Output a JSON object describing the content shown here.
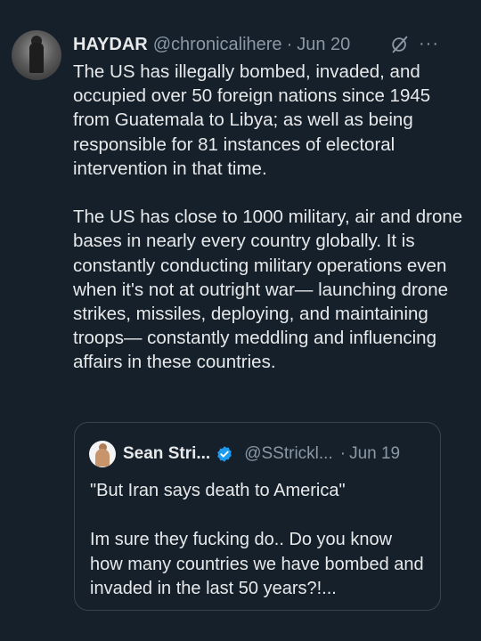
{
  "tweet": {
    "author": {
      "display_name": "HAYDAR",
      "handle": "@chronicalihere",
      "separator": "·",
      "date": "Jun 20"
    },
    "icons": {
      "grok": "grok-icon",
      "more": "more-options-icon",
      "more_glyph": "···"
    },
    "paragraphs": [
      "The US has illegally bombed, invaded, and occupied over 50 foreign nations since 1945 from Guatemala to Libya; as well as being responsible for 81 instances of electoral intervention in that time.",
      "The US has close to 1000 military, air and drone bases in nearly every country globally. It is constantly conducting military operations even when it's not at outright war— launching drone strikes, missiles, deploying, and maintaining troops— constantly meddling and influencing affairs in these countries."
    ],
    "quote": {
      "author": {
        "display_name": "Sean Stri...",
        "handle": "@SStrickl...",
        "separator": "·",
        "date": "Jun 19",
        "verified": true
      },
      "paragraphs": [
        "\"But Iran says death to America\"",
        "Im sure they fucking do.. Do you know how many countries we have bombed and invaded in the last 50 years?!..."
      ]
    }
  },
  "colors": {
    "background": "#15202b",
    "text": "#e7e9ea",
    "secondary_text": "#8b98a5",
    "border": "#38444d",
    "verified_badge": "#1d9bf0"
  }
}
